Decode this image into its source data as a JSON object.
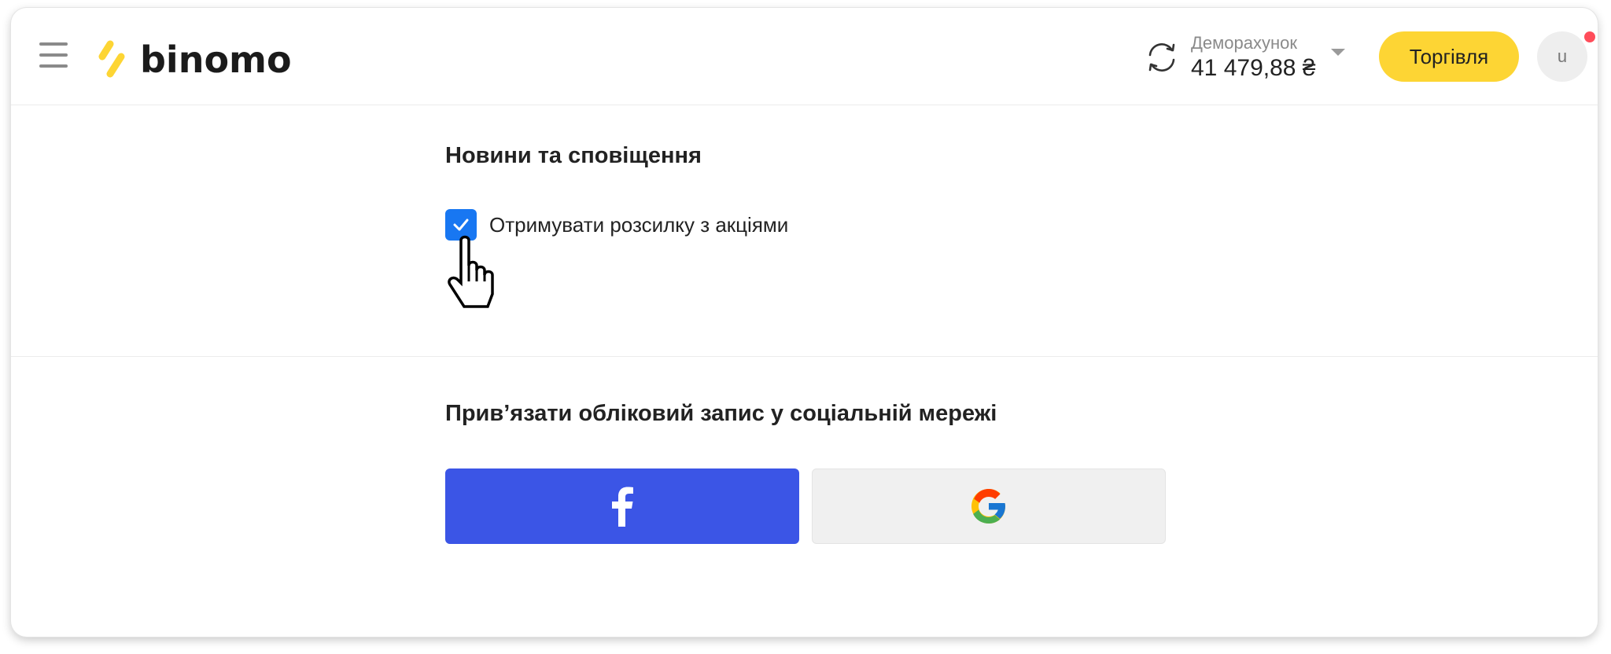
{
  "header": {
    "logo_text": "binomo",
    "account_label": "Деморахунок",
    "balance": "41 479,88 ₴",
    "trade_button": "Торгівля",
    "avatar_initial": "u"
  },
  "news": {
    "title": "Новини та сповіщення",
    "newsletter_label": "Отримувати розсилку з акціями",
    "newsletter_checked": true
  },
  "social": {
    "title": "Прив’язати обліковий запис у соціальній мережі",
    "facebook_icon": "facebook-icon",
    "google_icon": "google-icon"
  },
  "colors": {
    "brand_yellow": "#fdd534",
    "facebook_blue": "#3b55e6",
    "checkbox_blue": "#1877f2",
    "notification_red": "#ff4d5a"
  }
}
